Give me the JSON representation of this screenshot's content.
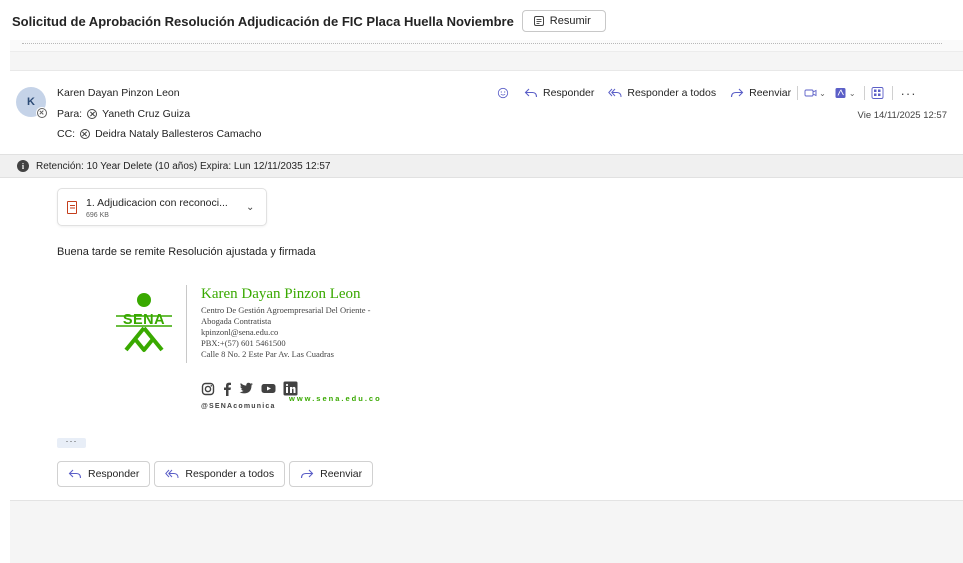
{
  "subject": "Solicitud de Aprobación Resolución Adjudicación de FIC Placa Huella Noviembre",
  "summarize_label": "Resumir",
  "message": {
    "avatar_initial": "K",
    "sender": "Karen Dayan Pinzon Leon",
    "to_label": "Para:",
    "to": "Yaneth Cruz Guiza",
    "cc_label": "CC:",
    "cc": "Deidra Nataly Ballesteros Camacho",
    "date": "Vie 14/11/2025 12:57"
  },
  "actions": {
    "reply": "Responder",
    "reply_all": "Responder a todos",
    "forward": "Reenviar",
    "more": "···"
  },
  "retention": "Retención: 10 Year Delete (10 años) Expira: Lun 12/11/2035 12:57",
  "attachment": {
    "name": "1. Adjudicacion con reconoci...",
    "size": "696 KB"
  },
  "body": "Buena tarde se remite Resolución ajustada y firmada",
  "signature": {
    "logo_text": "SENA",
    "name": "Karen Dayan Pinzon Leon",
    "lines": [
      "Centro De Gestión Agroempresarial Del Oriente -",
      "Abogada Contratista",
      "kpinzonl@sena.edu.co",
      "PBX:+(57) 601 5461500",
      "Calle 8 No. 2 Este Par Av. Las Cuadras"
    ],
    "handle": "@SENAcomunica",
    "website": "www.sena.edu.co"
  },
  "ellipsis": "···",
  "reply_buttons": {
    "reply": "Responder",
    "reply_all": "Responder a todos",
    "forward": "Reenviar"
  },
  "colors": {
    "sena_green": "#39a900",
    "accent_purple": "#5b5fc7",
    "pdf_red": "#c43e1c"
  }
}
